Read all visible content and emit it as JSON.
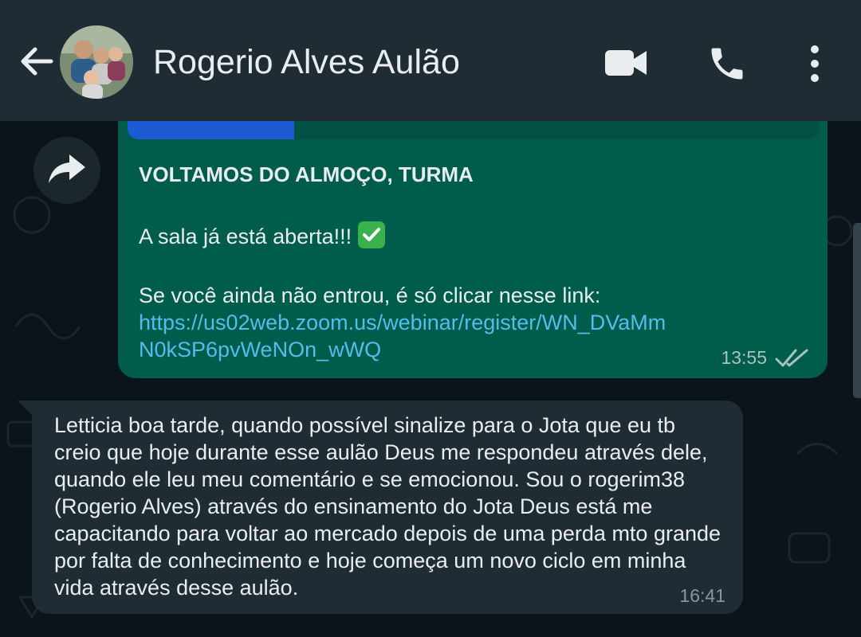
{
  "header": {
    "title": "Rogerio Alves Aulão",
    "back_icon": "arrow-left-icon",
    "video_icon": "video-camera-icon",
    "call_icon": "phone-icon",
    "more_icon": "more-vertical-icon"
  },
  "messages": {
    "outgoing": {
      "heading": "VOLTAMOS DO ALMOÇO, TURMA",
      "line2": "A sala já está aberta!!!",
      "line3": "Se você ainda não entrou, é só clicar nesse link:",
      "link": "https://us02web.zoom.us/webinar/register/WN_DVaMmN0kSP6pvWeNOn_wWQ",
      "time": "13:55",
      "status_icon": "double-check-icon"
    },
    "incoming": {
      "text": "Letticia boa tarde, quando possível sinalize para o Jota que eu tb creio que hoje durante esse aulão Deus me respondeu através dele, quando ele leu meu comentário e se emocionou. Sou o rogerim38 (Rogerio Alves) através do ensinamento do Jota Deus está me capacitando para voltar ao mercado depois de uma perda mto grande por falta de conhecimento e hoje começa um novo ciclo em minha vida através desse aulão.",
      "time": "16:41"
    }
  },
  "colors": {
    "header_bg": "#1f2c34",
    "chat_bg": "#0b141a",
    "outgoing_bubble": "#005c4b",
    "incoming_bubble": "#202c33",
    "link": "#53bdeb"
  }
}
